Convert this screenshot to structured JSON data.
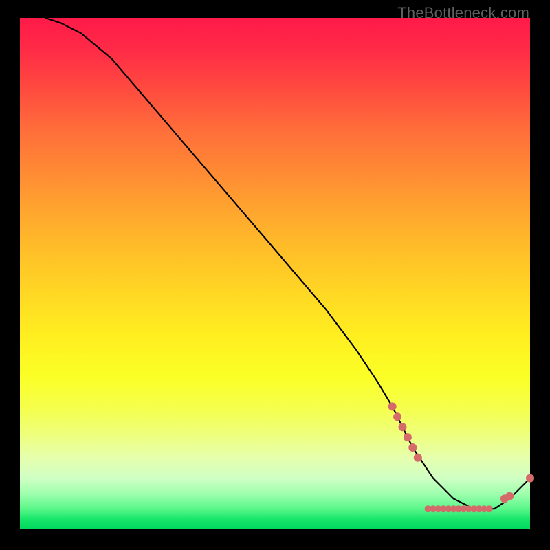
{
  "attribution": "TheBottleneck.com",
  "colors": {
    "line": "#000000",
    "marker": "#d46a6a",
    "frame_bg_top": "#ff1a48",
    "frame_bg_bottom": "#00d85e",
    "page_bg": "#000000"
  },
  "chart_data": {
    "type": "line",
    "title": "",
    "xlabel": "",
    "ylabel": "",
    "xlim": [
      0,
      100
    ],
    "ylim": [
      0,
      100
    ],
    "x": [
      5,
      8,
      12,
      18,
      24,
      30,
      36,
      42,
      48,
      54,
      60,
      66,
      70,
      73,
      75,
      77,
      79,
      81,
      83,
      85,
      87,
      89,
      91,
      93,
      96,
      100
    ],
    "values": [
      100,
      99,
      97,
      92,
      85,
      78,
      71,
      64,
      57,
      50,
      43,
      35,
      29,
      24,
      20,
      16,
      13,
      10,
      8,
      6,
      5,
      4,
      4,
      4,
      6,
      10
    ],
    "series": [
      {
        "name": "curve",
        "x": [
          5,
          8,
          12,
          18,
          24,
          30,
          36,
          42,
          48,
          54,
          60,
          66,
          70,
          73,
          75,
          77,
          79,
          81,
          83,
          85,
          87,
          89,
          91,
          93,
          96,
          100
        ],
        "values": [
          100,
          99,
          97,
          92,
          85,
          78,
          71,
          64,
          57,
          50,
          43,
          35,
          29,
          24,
          20,
          16,
          13,
          10,
          8,
          6,
          5,
          4,
          4,
          4,
          6,
          10
        ]
      }
    ],
    "markers": {
      "cluster_a": {
        "x": [
          73,
          74,
          75,
          76,
          77,
          78
        ],
        "y": [
          24,
          22,
          20,
          18,
          16,
          14
        ]
      },
      "band_b": {
        "x": [
          80,
          81,
          82,
          83,
          84,
          85,
          86,
          87,
          88,
          89,
          90,
          91,
          92
        ],
        "y": [
          4,
          4,
          4,
          4,
          4,
          4,
          4,
          4,
          4,
          4,
          4,
          4,
          4
        ]
      },
      "pair_c": {
        "x": [
          95,
          96
        ],
        "y": [
          6,
          6.5
        ]
      },
      "end": {
        "x": [
          100
        ],
        "y": [
          10
        ]
      }
    }
  }
}
